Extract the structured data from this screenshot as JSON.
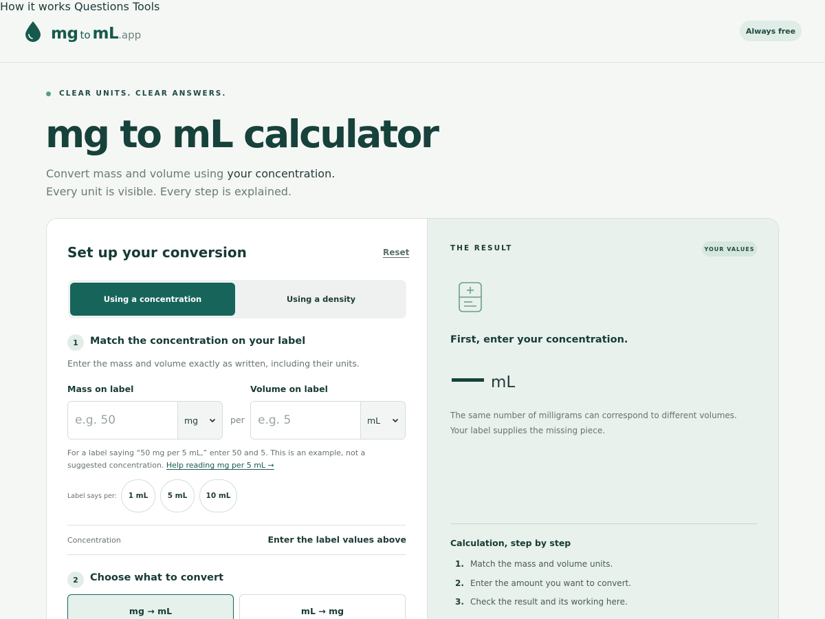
{
  "header": {
    "logo": {
      "mg": "mg",
      "to": "to",
      "ml": "mL",
      "app": ".app"
    },
    "nav": [
      "How it works",
      "Questions",
      "Tools"
    ],
    "badge": "Always free"
  },
  "hero": {
    "eyebrow": "CLEAR UNITS. CLEAR ANSWERS.",
    "title": "mg to mL calculator",
    "subtitle_prefix": "Convert mass and volume using ",
    "subtitle_strong": "your concentration.",
    "subtitle_line2": "Every unit is visible. Every step is explained."
  },
  "setup": {
    "title": "Set up your conversion",
    "reset": "Reset",
    "modes": [
      "Using a concentration",
      "Using a density"
    ],
    "step1": {
      "number": "1",
      "title": "Match the concentration on your label",
      "help": "Enter the mass and volume exactly as written, including their units.",
      "mass_label": "Mass on label",
      "mass_placeholder": "e.g. 50",
      "mass_unit": "mg",
      "per": "per",
      "volume_label": "Volume on label",
      "volume_placeholder": "e.g. 5",
      "volume_unit": "mL",
      "example": "For a label saying “50 mg per 5 mL,” enter 50 and 5. This is an example, not a suggested concentration.",
      "example_link": "Help reading mg per 5 mL →",
      "chips_label": "Label says per:",
      "chips": [
        "1 mL",
        "5 mL",
        "10 mL"
      ],
      "concentration_label": "Concentration",
      "concentration_value": "Enter the label values above"
    },
    "step2": {
      "number": "2",
      "title": "Choose what to convert",
      "directions": [
        "mg → mL",
        "mL → mg"
      ]
    }
  },
  "result": {
    "eyebrow": "THE RESULT",
    "badge": "YOUR VALUES",
    "prompt": "First, enter your concentration.",
    "unit": "mL",
    "note": "The same number of milligrams can correspond to different volumes. Your label supplies the missing piece.",
    "calc_title": "Calculation, step by step",
    "steps": [
      {
        "n": "1.",
        "text": "Match the mass and volume units."
      },
      {
        "n": "2.",
        "text": "Enter the amount you want to convert."
      },
      {
        "n": "3.",
        "text": "Check the result and its working here."
      }
    ]
  },
  "colors": {
    "brand": "#17645a",
    "text": "#173a35",
    "panel": "#e8f1ec"
  }
}
